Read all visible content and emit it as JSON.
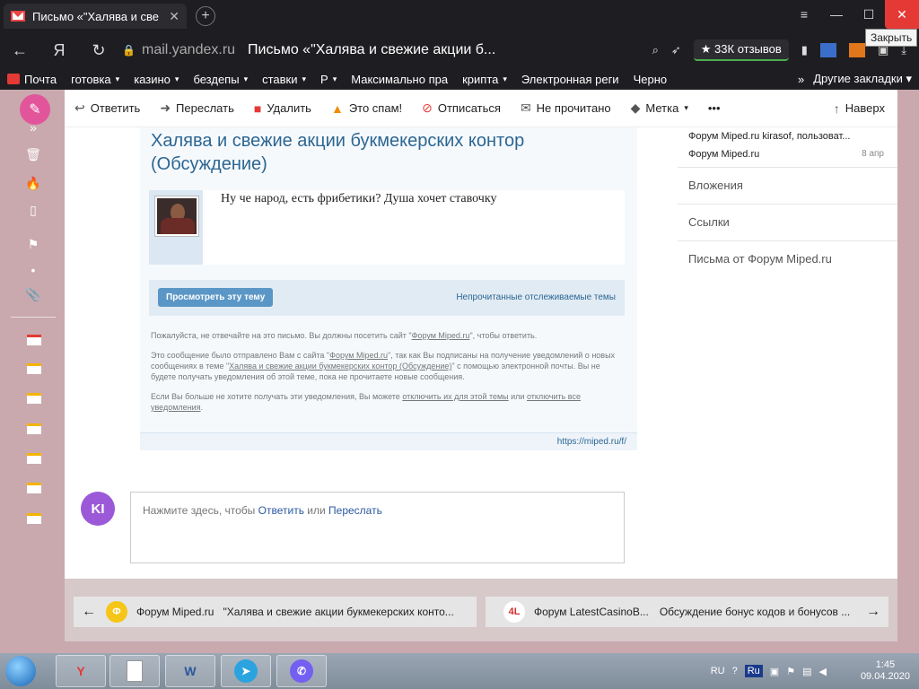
{
  "browser": {
    "tab_title": "Письмо «\"Халява и све",
    "url_host": "mail.yandex.ru",
    "url_title": "Письмо «\"Халява и свежие акции б...",
    "reviews": "★ 33К отзывов",
    "tooltip": "Закрыть",
    "bookmarks": [
      {
        "label": "Почта",
        "caret": ""
      },
      {
        "label": "готовка",
        "caret": "▾"
      },
      {
        "label": "казино",
        "caret": "▾"
      },
      {
        "label": "бездепы",
        "caret": "▾"
      },
      {
        "label": "ставки",
        "caret": "▾"
      },
      {
        "label": "Р",
        "caret": "▾"
      },
      {
        "label": "Максимально пра",
        "caret": ""
      },
      {
        "label": "крипта",
        "caret": "▾"
      },
      {
        "label": "Электронная реги",
        "caret": ""
      },
      {
        "label": "Черно",
        "caret": ""
      }
    ],
    "bookmarks_more": "»",
    "other_bookmarks": "Другие закладки ▾"
  },
  "toolbar": {
    "reply": "Ответить",
    "forward": "Переслать",
    "delete": "Удалить",
    "spam": "Это спам!",
    "unsubscribe": "Отписаться",
    "unread": "Не прочитано",
    "label": "Метка",
    "more": "•••",
    "top": "Наверх"
  },
  "email": {
    "subject": "Халява и свежие акции букмекерских контор (Обсуждение)",
    "post_text": "Ну че народ, есть фрибетики? Душа хочет ставочку",
    "view_button": "Просмотреть эту тему",
    "unread_link": "Непрочитанные отслеживаемые темы",
    "footer1_a": "Пожалуйста, не отвечайте на это письмо. Вы должны посетить сайт \"",
    "footer1_link": "Форум Miped.ru",
    "footer1_b": "\", чтобы ответить.",
    "footer2_a": "Это сообщение было отправлено Вам с сайта \"",
    "footer2_link": "Форум Miped.ru",
    "footer2_b": "\", так как Вы подписаны на получение уведомлений о новых сообщениях в теме \"",
    "footer2_link2": "Халява и свежие акции букмекерских контор (Обсуждение)",
    "footer2_c": "\" с помощью электронной почты. Вы не будете получать уведомления об этой теме, пока не прочитаете новые сообщения.",
    "footer3_a": "Если Вы больше не хотите получать эти уведомления, Вы можете ",
    "footer3_link": "отключить их для этой темы",
    "footer3_b": " или ",
    "footer3_link2": "отключить все уведомления",
    "footer3_c": ".",
    "site_url": "https://miped.ru/f/"
  },
  "reply": {
    "avatar": "KI",
    "prompt_a": "Нажмите здесь, чтобы ",
    "reply_link": "Ответить",
    "prompt_b": " или ",
    "forward_link": "Переслать"
  },
  "right": {
    "thread1": "Форум Miped.ru kirasof, пользоват...",
    "thread2": "Форум Miped.ru",
    "thread2_date": "8 апр",
    "attachments": "Вложения",
    "links": "Ссылки",
    "letters_from": "Письма от Форум Miped.ru"
  },
  "bottomnav": {
    "prev_sender": "Форум Miped.ru",
    "prev_subject": "\"Халява и свежие акции букмекерских конто...",
    "prev_badge": "Ф",
    "next_sender": "Форум LatestCasinoB...",
    "next_subject": "Обсуждение бонус кодов и бонусов ...",
    "next_badge": "4L"
  },
  "taskbar": {
    "lang": "RU",
    "lang_badge": "Ru",
    "time": "1:45",
    "date": "09.04.2020",
    "word_label": "W",
    "yandex_label": "Y"
  }
}
